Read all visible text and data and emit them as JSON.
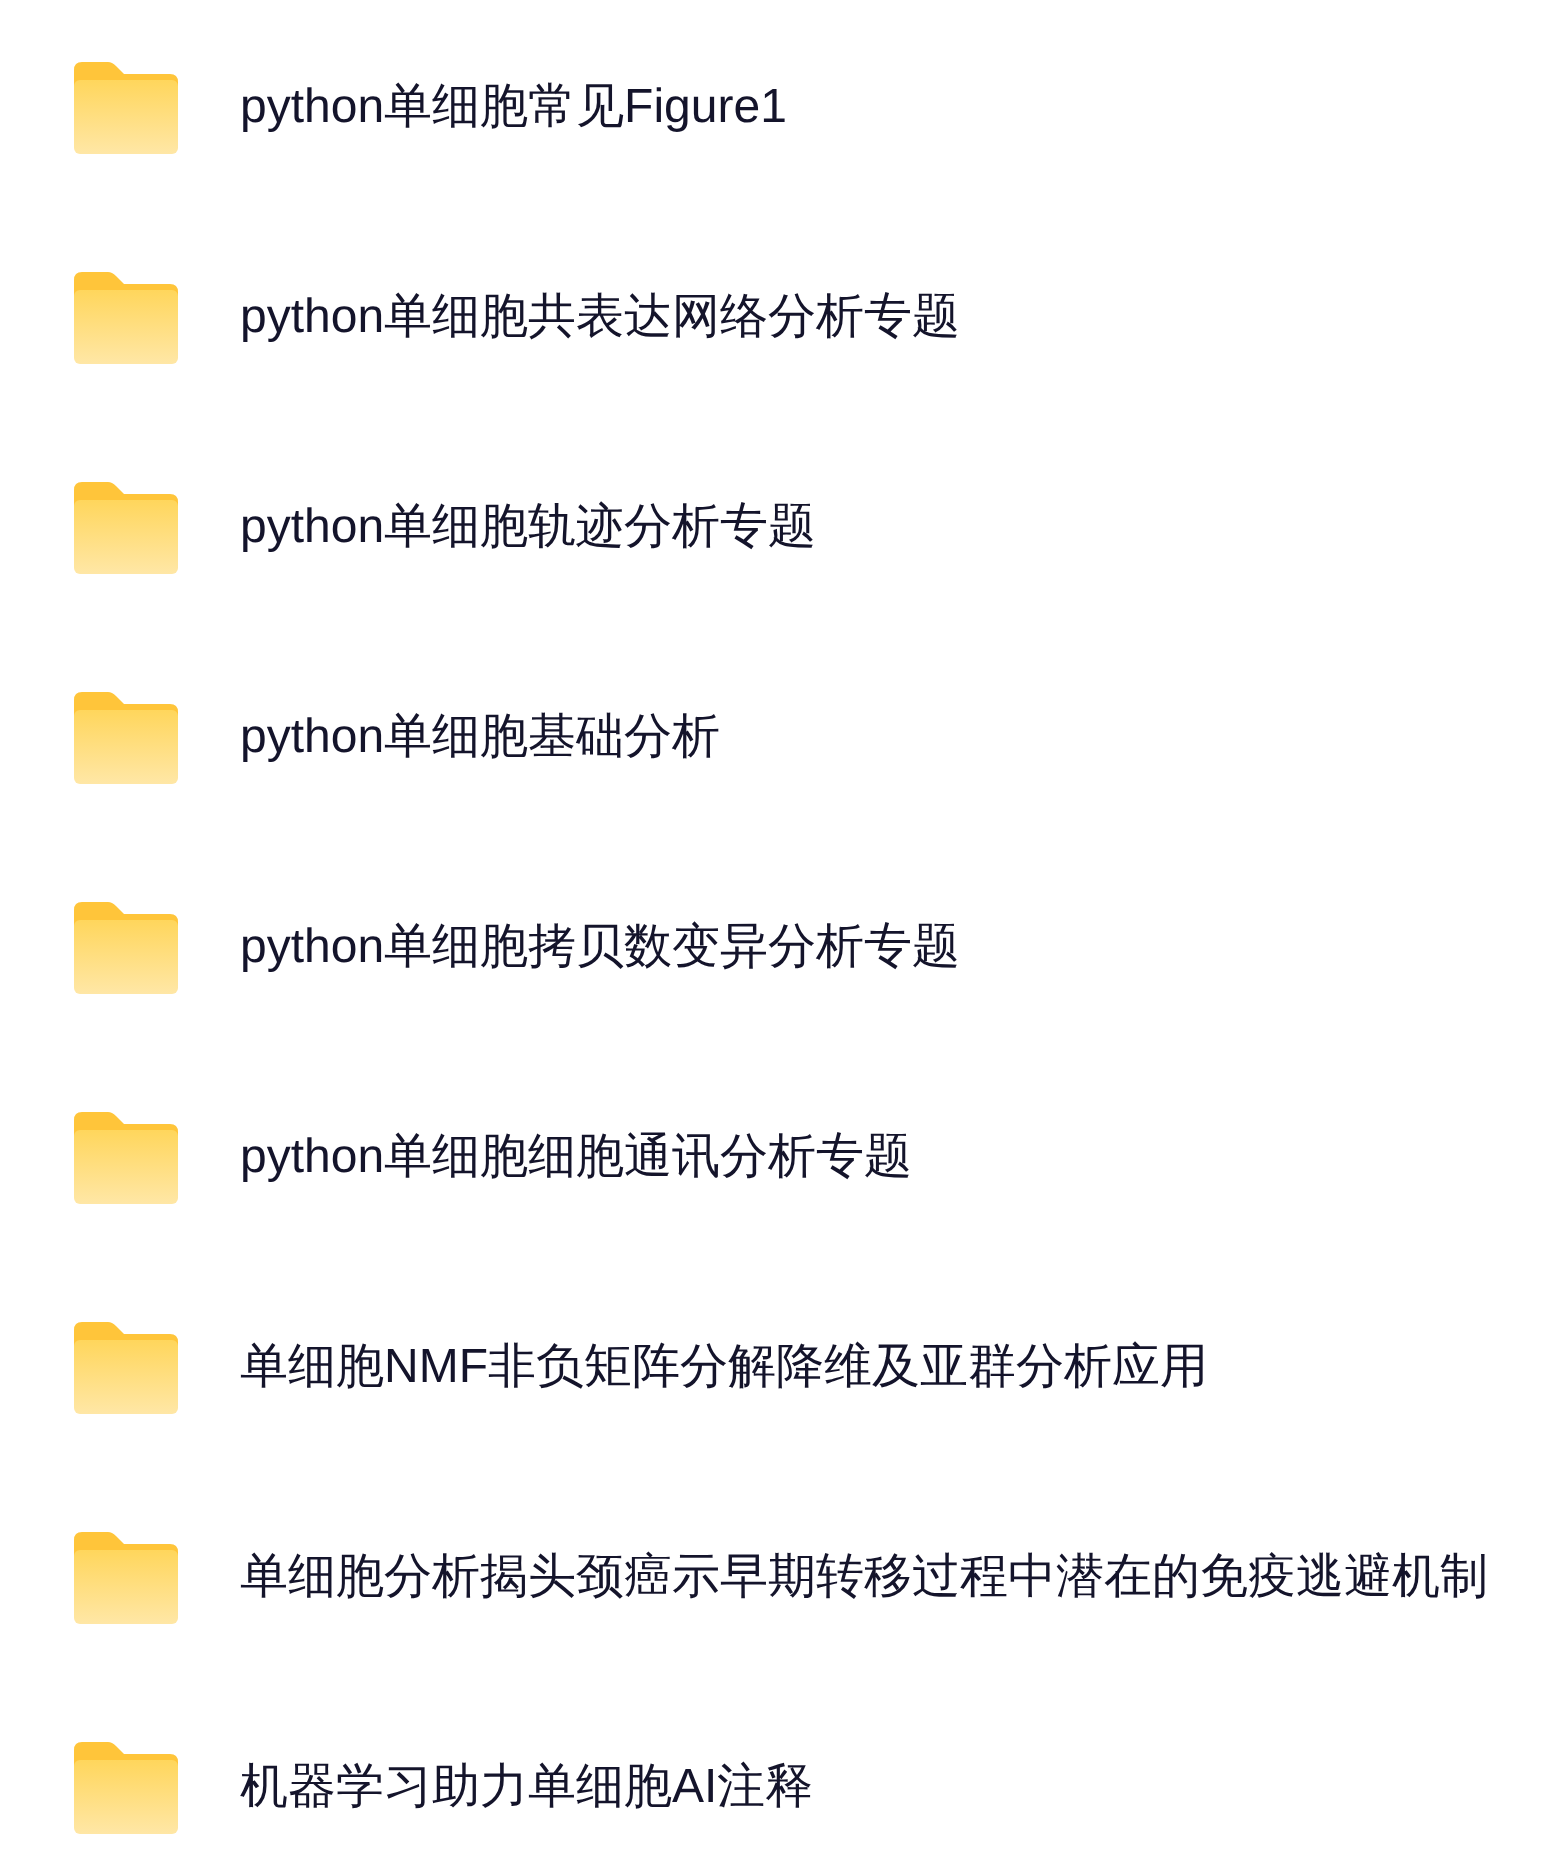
{
  "folders": [
    {
      "name": "python单细胞常见Figure1"
    },
    {
      "name": "python单细胞共表达网络分析专题"
    },
    {
      "name": "python单细胞轨迹分析专题"
    },
    {
      "name": "python单细胞基础分析"
    },
    {
      "name": "python单细胞拷贝数变异分析专题"
    },
    {
      "name": "python单细胞细胞通讯分析专题"
    },
    {
      "name": "单细胞NMF非负矩阵分解降维及亚群分析应用"
    },
    {
      "name": "单细胞分析揭头颈癌示早期转移过程中潜在的免疫逃避机制"
    },
    {
      "name": "机器学习助力单细胞AI注释"
    }
  ]
}
